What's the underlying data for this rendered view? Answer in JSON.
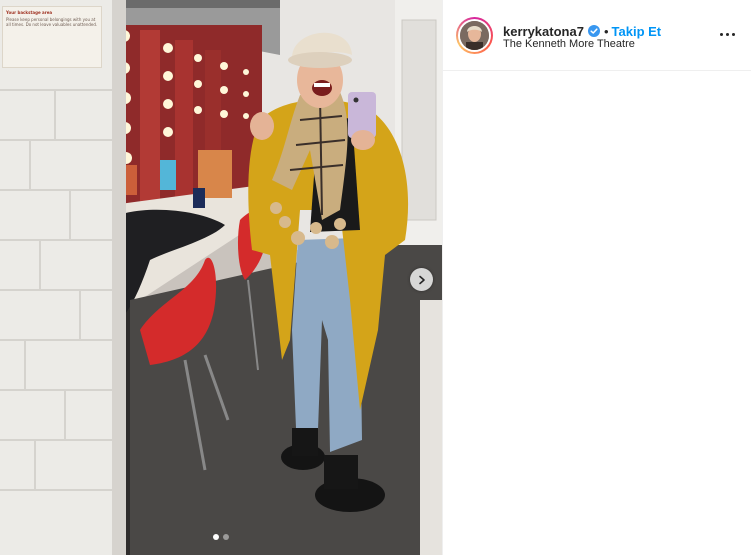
{
  "post": {
    "username": "kerrykatona7",
    "separator": "•",
    "follow_label": "Takip Et",
    "location": "The Kenneth More Theatre",
    "verified": true
  },
  "photo": {
    "notice_heading": "Your backstage area",
    "notice_body": "Please keep personal belongings with you at all times. Do not leave valuables unattended.",
    "carousel": {
      "current": 1,
      "total": 2
    }
  },
  "icons": {
    "next": "chevron-right-icon",
    "verified": "verified-badge-icon",
    "more": "more-options-icon"
  },
  "colors": {
    "follow": "#0095f6",
    "verified": "#3897f0",
    "text": "#262626"
  }
}
